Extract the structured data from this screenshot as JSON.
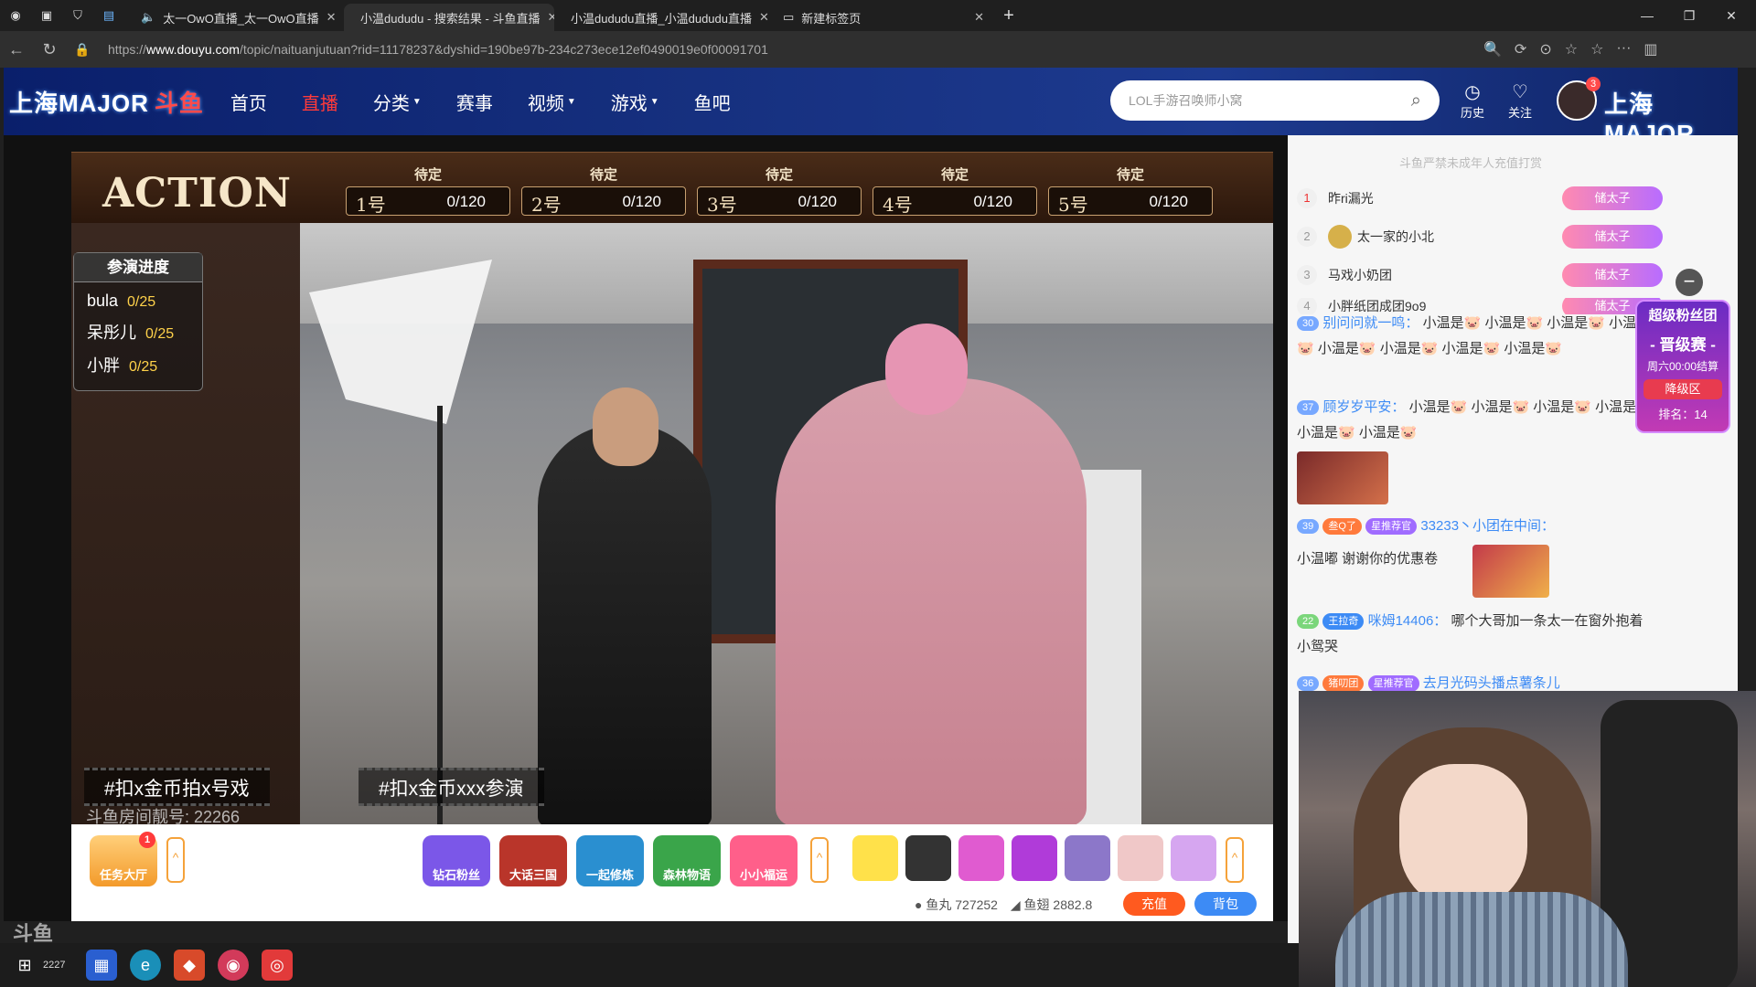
{
  "browser": {
    "tabs": [
      {
        "title": "太一OwO直播_太一OwO直播",
        "active": false
      },
      {
        "title": "小温dududu - 搜索结果 - 斗鱼直播",
        "active": true
      },
      {
        "title": "小温dududu直播_小温dududu直播",
        "active": false
      },
      {
        "title": "新建标签页",
        "active": false
      }
    ],
    "url_prefix": "https://",
    "url_domain": "www.douyu.com",
    "url_path": "/topic/naituanjutuan?rid=11178237&dyshid=190be97b-234c273ece12ef0490019e0f00091701"
  },
  "header": {
    "logo_left": "上海MAJOR",
    "logo_brand": "斗鱼",
    "logo_right": "上海MAJOR",
    "nav": [
      {
        "label": "首页",
        "active": false,
        "dropdown": false
      },
      {
        "label": "直播",
        "active": true,
        "dropdown": false
      },
      {
        "label": "分类",
        "active": false,
        "dropdown": true
      },
      {
        "label": "赛事",
        "active": false,
        "dropdown": false
      },
      {
        "label": "视频",
        "active": false,
        "dropdown": true
      },
      {
        "label": "游戏",
        "active": false,
        "dropdown": true
      },
      {
        "label": "鱼吧",
        "active": false,
        "dropdown": false
      }
    ],
    "search_placeholder": "LOL手游召唤师小窝",
    "history_label": "历史",
    "follow_label": "关注",
    "avatar_badge": "3"
  },
  "action": {
    "title": "ACTION",
    "slots": [
      {
        "status": "待定",
        "num": "1号",
        "count": "0/120"
      },
      {
        "status": "待定",
        "num": "2号",
        "count": "0/120"
      },
      {
        "status": "待定",
        "num": "3号",
        "count": "0/120"
      },
      {
        "status": "待定",
        "num": "4号",
        "count": "0/120"
      },
      {
        "status": "待定",
        "num": "5号",
        "count": "0/120"
      }
    ]
  },
  "progress": {
    "title": "参演进度",
    "rows": [
      {
        "name": "bula",
        "value": "0/25"
      },
      {
        "name": "呆彤儿",
        "value": "0/25"
      },
      {
        "name": "小胖",
        "value": "0/25"
      }
    ]
  },
  "video": {
    "hashtag1": "#扣x金币拍x号戏",
    "hashtag2": "#扣x金币xxx参演",
    "room_id": "斗鱼房间靓号: 22266"
  },
  "bottom": {
    "task_label": "任务大厅",
    "task_badge": "1",
    "gifts": [
      {
        "label": "钻石粉丝",
        "color": "#7b57e8"
      },
      {
        "label": "大话三国",
        "color": "#b9352a"
      },
      {
        "label": "一起修炼",
        "color": "#2a8fd0"
      },
      {
        "label": "森林物语",
        "color": "#3aa54a"
      },
      {
        "label": "小小福运",
        "color": "#ff5f8a"
      }
    ],
    "fish_ball_label": "鱼丸",
    "fish_ball_value": "727252",
    "fish_wing_label": "鱼翅",
    "fish_wing_value": "2882.8",
    "recharge_label": "充值",
    "bag_label": "背包"
  },
  "rank": {
    "note": "斗鱼严禁未成年人充值打赏",
    "rows": [
      {
        "rank": "1",
        "name": "昨ri漏光",
        "badge": "储太子"
      },
      {
        "rank": "2",
        "name": "太一家的小北",
        "badge": "储太子"
      },
      {
        "rank": "3",
        "name": "马戏小奶团",
        "badge": "储太子"
      },
      {
        "rank": "4",
        "name": "小胖纸团成团9o9",
        "badge": "储太子"
      }
    ]
  },
  "chat": [
    {
      "level": "30",
      "user": "别问问就一鸣：",
      "text": "小温是🐷 小温是🐷 小温是🐷 小温是🐷 小温是🐷 小温是🐷 小温是🐷 小温是🐷"
    },
    {
      "level": "37",
      "user": "顾岁岁平安：",
      "text": "小温是🐷 小温是🐷 小温是🐷 小温是🐷 小温是🐷 小温是🐷"
    },
    {
      "level": "39",
      "tag": "叁Q了",
      "tag2": "星推荐官",
      "user": "33233丶小团在中间：",
      "text": "小温嘟 谢谢你的优惠卷"
    },
    {
      "level": "22",
      "tag": "王拉奇",
      "user": "咪姆14406：",
      "text": "哪个大哥加一条太一在窗外抱着小鸳哭"
    },
    {
      "level": "36",
      "tag": "猪叨团",
      "tag2": "星推荐官",
      "user": "去月光码头播点薯条儿",
      "text": ""
    }
  ],
  "fanclub": {
    "title": "超级粉丝团",
    "event": "- 晋级赛 -",
    "time": "周六00:00结算",
    "zone": "降级区",
    "rank": "排名：14"
  },
  "taskbar": {
    "time": "2227"
  },
  "watermark": "斗鱼"
}
